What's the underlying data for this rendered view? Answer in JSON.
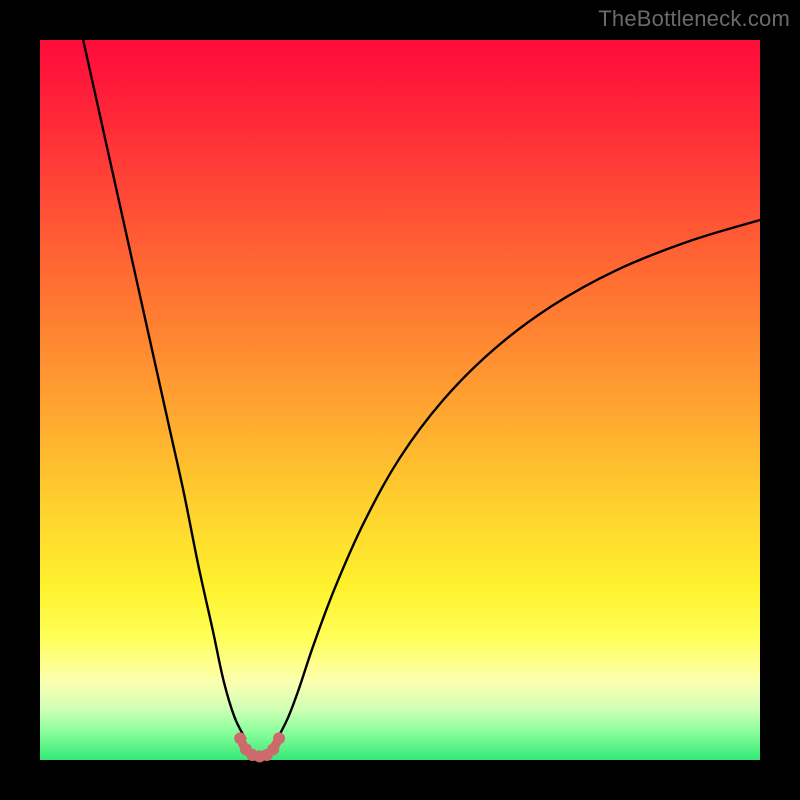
{
  "watermark": "TheBottleneck.com",
  "chart_data": {
    "type": "line",
    "title": "",
    "xlabel": "",
    "ylabel": "",
    "xlim": [
      0,
      100
    ],
    "ylim": [
      0,
      100
    ],
    "grid": false,
    "background_gradient": [
      "#ff0b3a",
      "#ffb52f",
      "#fff22d",
      "#34e87a"
    ],
    "series": [
      {
        "name": "left-curve",
        "stroke": "#000000",
        "x": [
          6,
          8,
          10,
          12,
          14,
          16,
          18,
          20,
          22,
          24,
          25.5,
          27,
          28.5
        ],
        "y": [
          100,
          91,
          82,
          73,
          64,
          55,
          46,
          37,
          27,
          18,
          11,
          6,
          3
        ]
      },
      {
        "name": "right-curve",
        "stroke": "#000000",
        "x": [
          33,
          34.5,
          36,
          38,
          41,
          45,
          50,
          56,
          63,
          71,
          80,
          90,
          100
        ],
        "y": [
          3,
          6,
          10,
          16,
          24,
          33,
          42,
          50,
          57,
          63,
          68,
          72,
          75
        ]
      },
      {
        "name": "bottom-arc",
        "stroke": "#cc6b6b",
        "x": [
          27.8,
          28.5,
          29.3,
          30.0,
          30.8,
          31.6,
          32.4,
          33.2
        ],
        "y": [
          3.0,
          1.6,
          0.8,
          0.5,
          0.5,
          0.8,
          1.6,
          3.0
        ]
      }
    ],
    "markers": [
      {
        "series": "bottom-arc",
        "shape": "circle",
        "color": "#cc6b6b",
        "radius_px": 6,
        "x": [
          27.8,
          28.6,
          29.5,
          30.5,
          31.5,
          32.4,
          33.2
        ],
        "y": [
          3.0,
          1.5,
          0.7,
          0.5,
          0.7,
          1.5,
          3.0
        ]
      }
    ]
  }
}
